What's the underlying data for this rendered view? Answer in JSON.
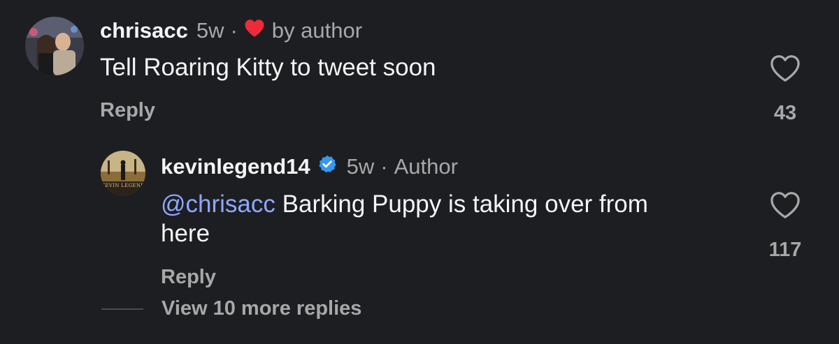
{
  "comment": {
    "username": "chrisacc",
    "time": "5w",
    "separator": "·",
    "liked_by": "by author",
    "text": "Tell Roaring Kitty to tweet soon",
    "reply_label": "Reply",
    "like_count": "43"
  },
  "reply": {
    "username": "kevinlegend14",
    "time": "5w",
    "separator": "·",
    "author_tag": "Author",
    "mention": "@chrisacc",
    "text_line1": " Barking Puppy is taking over from",
    "text_line2": "here",
    "reply_label": "Reply",
    "like_count": "117",
    "avatar_text": "KEVIN LEGEND"
  },
  "view_more": "View 10 more replies",
  "colors": {
    "background": "#1d1e22",
    "liked_heart": "#ed2b3a",
    "verified": "#3897f0",
    "mention": "#8ea7ff"
  }
}
